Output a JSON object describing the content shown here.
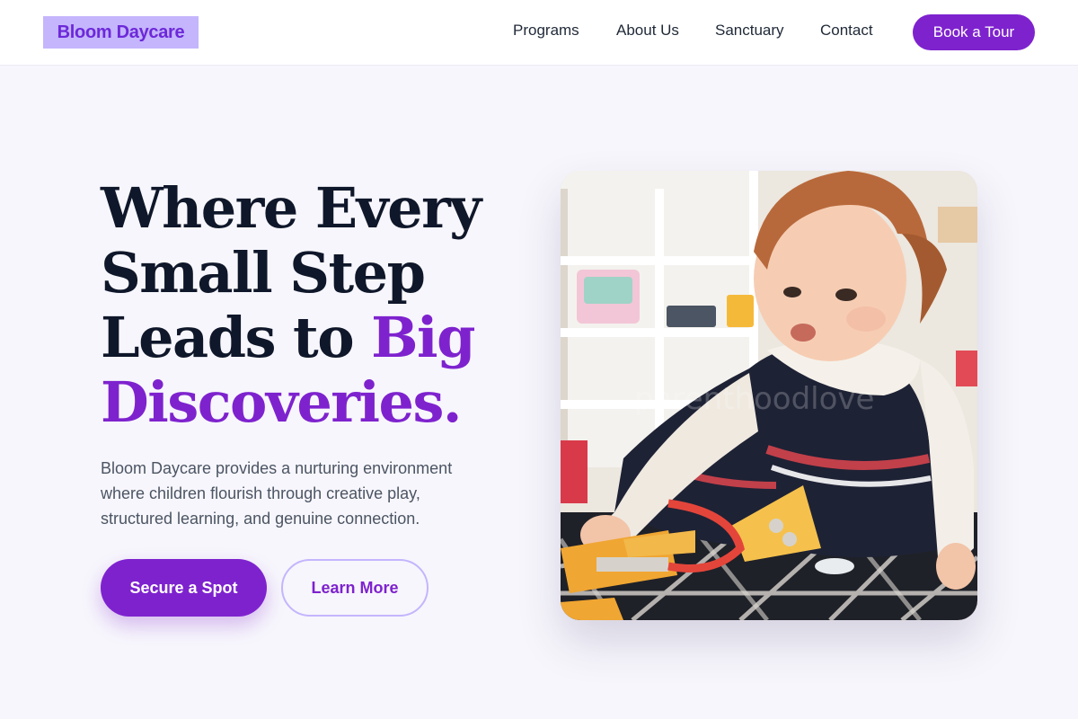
{
  "brand": {
    "name": "Bloom Daycare"
  },
  "nav": {
    "items": [
      {
        "label": "Programs"
      },
      {
        "label": "About Us"
      },
      {
        "label": "Sanctuary"
      },
      {
        "label": "Contact"
      }
    ],
    "cta_label": "Book a Tour"
  },
  "hero": {
    "headline_part1": "Where Every Small Step Leads to ",
    "headline_accent": "Big Discoveries.",
    "lead": "Bloom Daycare provides a nurturing environment where children flourish through creative play, structured learning, and genuine connection.",
    "primary_cta": "Secure a Spot",
    "secondary_cta": "Learn More",
    "image_watermark": "parenthoodlove"
  },
  "colors": {
    "accent": "#7e22ce",
    "logo_bg": "#c4b5fd",
    "page_bg": "#f7f6fc",
    "heading": "#0f172a"
  }
}
